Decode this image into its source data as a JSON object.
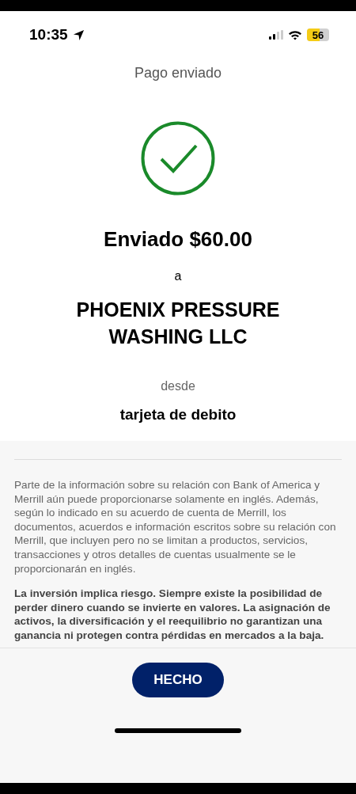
{
  "status_bar": {
    "time": "10:35",
    "battery": "56"
  },
  "header": {
    "title": "Pago enviado"
  },
  "confirmation": {
    "amount_line": "Enviado $60.00",
    "to_label": "a",
    "payee": "PHOENIX PRESSURE WASHING LLC",
    "from_label": "desde",
    "source": "tarjeta de debito"
  },
  "disclosures": [
    {
      "kind": "regular",
      "text": "Parte de la información sobre su relación con Bank of America y Merrill aún puede proporcionarse solamente en inglés. Además, según lo indicado en su acuerdo de cuenta de Merrill, los documentos, acuerdos e información escritos sobre su relación con Merrill, que incluyen pero no se limitan a productos, servicios, transacciones y otros detalles de cuentas usualmente se le proporcionarán en inglés."
    },
    {
      "kind": "bold",
      "text": "La inversión implica riesgo. Siempre existe la posibilidad de perder dinero cuando se invierte en valores. La asignación de activos, la diversificación y el reequilibrio no garantizan una ganancia ni protegen contra pérdidas en mercados a la baja."
    }
  ],
  "done_button": "HECHO"
}
